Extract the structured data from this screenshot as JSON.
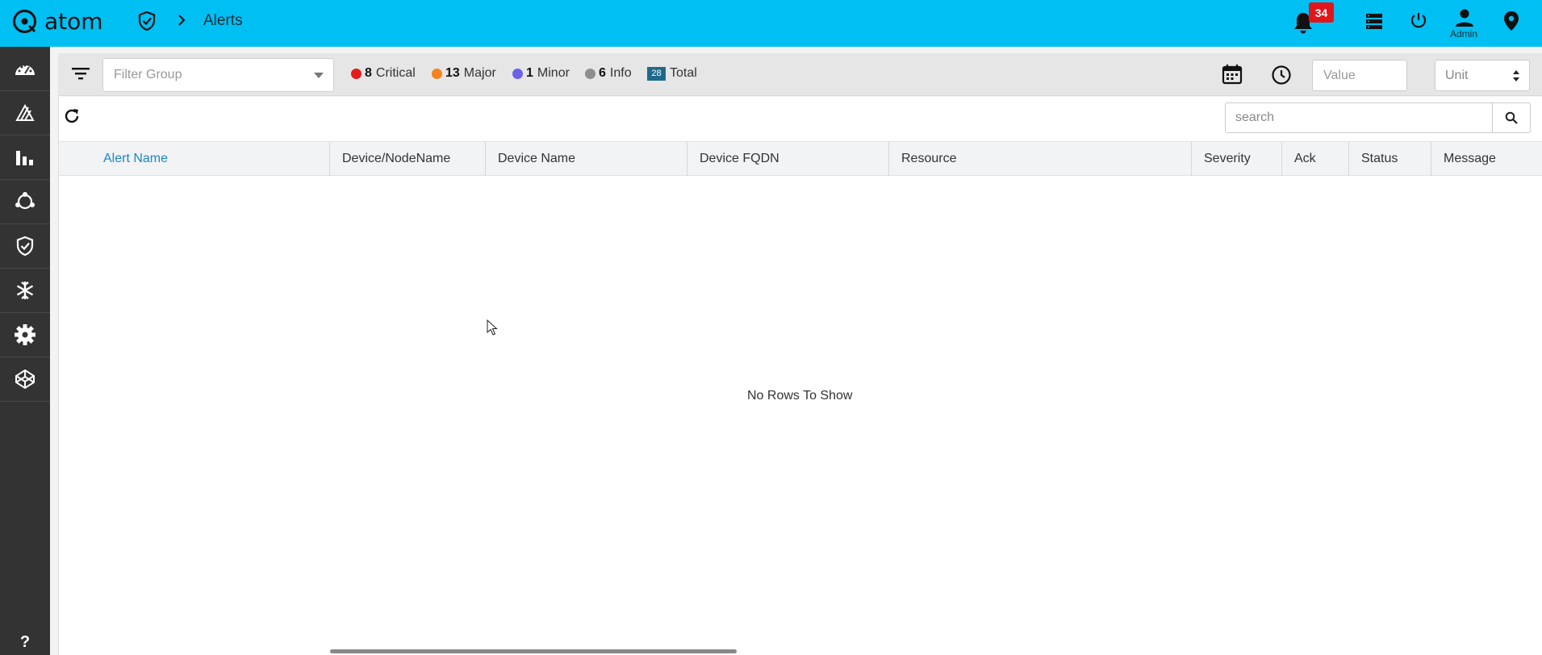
{
  "app": {
    "name": "atom"
  },
  "breadcrumb": {
    "title": "Alerts"
  },
  "topbar": {
    "notification_count": "34",
    "user_label": "Admin"
  },
  "sidebar": {
    "items": [
      {
        "icon": "dashboard-icon"
      },
      {
        "icon": "devices-icon"
      },
      {
        "icon": "analytics-icon"
      },
      {
        "icon": "topology-icon"
      },
      {
        "icon": "compliance-icon"
      },
      {
        "icon": "snowflake-icon"
      },
      {
        "icon": "settings-icon"
      },
      {
        "icon": "codepen-icon"
      }
    ],
    "help_label": "?"
  },
  "filter_bar": {
    "filter_group_placeholder": "Filter Group",
    "severities": [
      {
        "count": "8",
        "label": "Critical",
        "color": "#e51c1c"
      },
      {
        "count": "13",
        "label": "Major",
        "color": "#f5841f"
      },
      {
        "count": "1",
        "label": "Minor",
        "color": "#6b62e8"
      },
      {
        "count": "6",
        "label": "Info",
        "color": "#8e8e8e"
      }
    ],
    "total": {
      "count": "28",
      "label": "Total",
      "color": "#1f6a8b"
    },
    "value_placeholder": "Value",
    "unit_label": "Unit"
  },
  "table": {
    "search_placeholder": "search",
    "columns": [
      "Alert Name",
      "Device/NodeName",
      "Device Name",
      "Device FQDN",
      "Resource",
      "Severity",
      "Ack",
      "Status",
      "Message"
    ],
    "empty_message": "No Rows To Show"
  },
  "colors": {
    "topbar": "#00bff3",
    "sidebar": "#333333",
    "accent_link": "#1f87c0"
  }
}
